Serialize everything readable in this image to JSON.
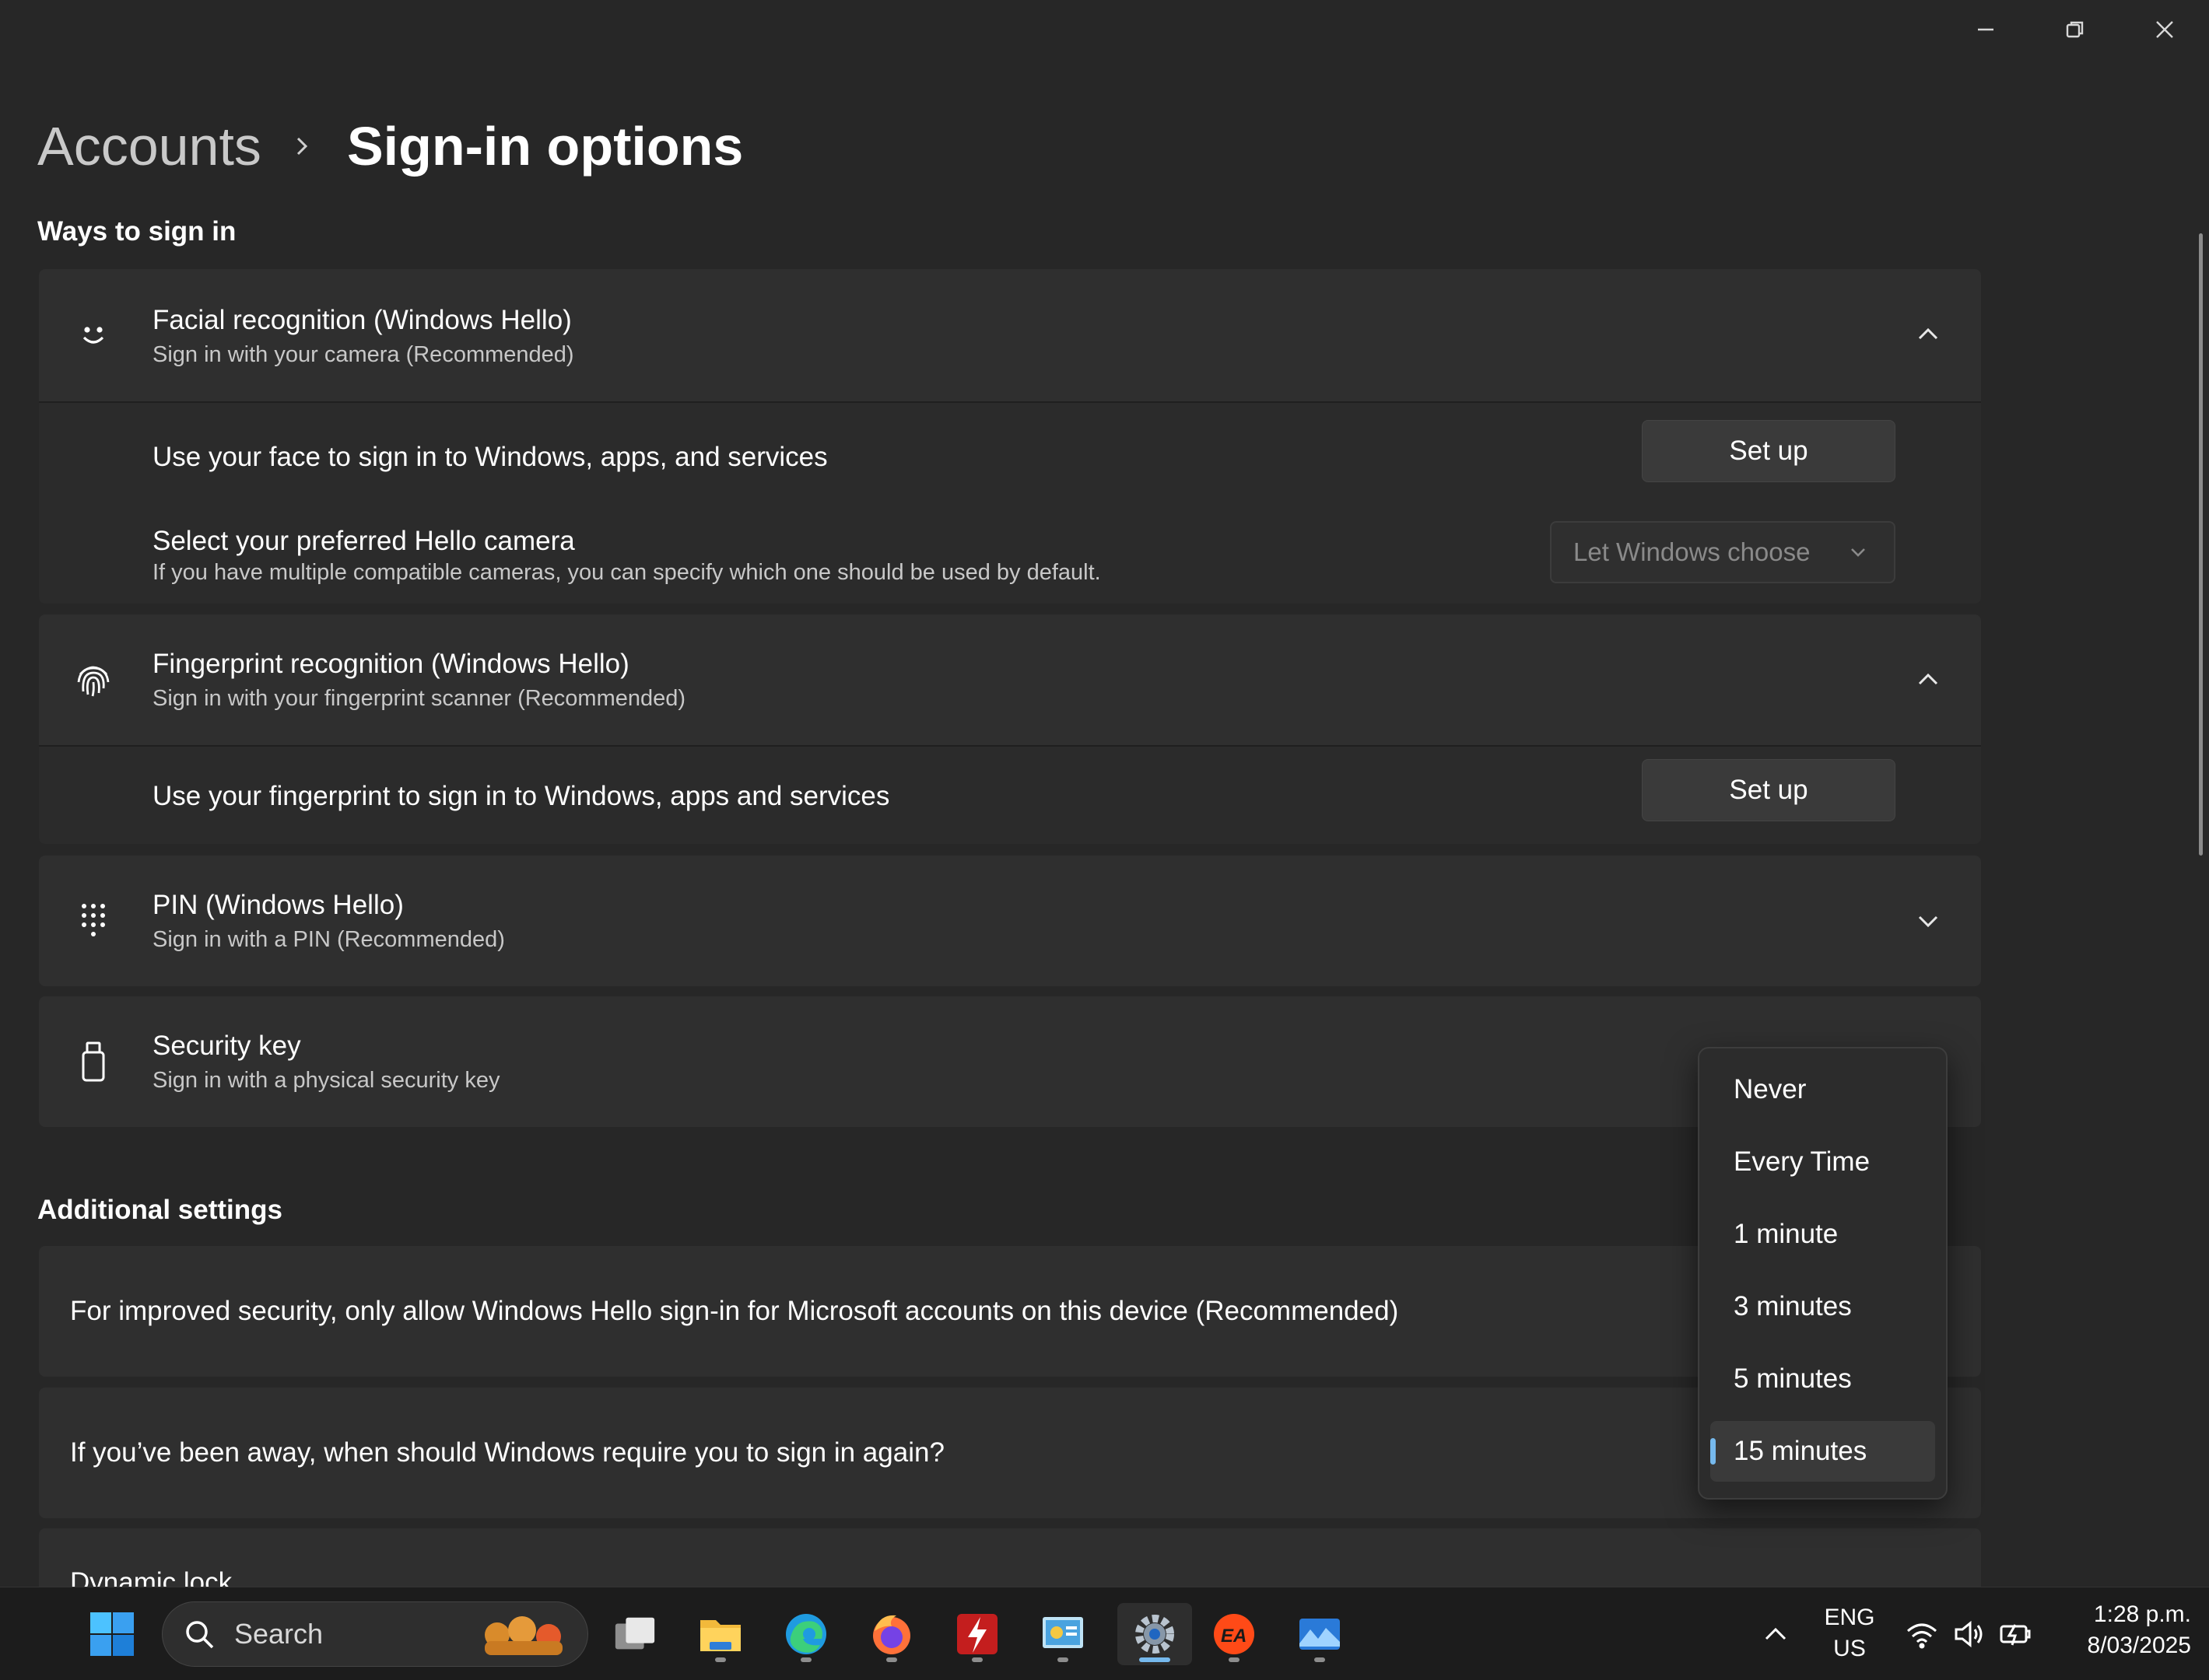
{
  "window": {
    "minimize_icon": "minimize-icon",
    "restore_icon": "restore-icon",
    "close_icon": "close-icon"
  },
  "breadcrumb": {
    "parent": "Accounts",
    "current": "Sign-in options"
  },
  "ways_section": {
    "title": "Ways to sign in",
    "facial": {
      "title": "Facial recognition (Windows Hello)",
      "subtitle": "Sign in with your camera (Recommended)",
      "row1_label": "Use your face to sign in to Windows, apps, and services",
      "row1_button": "Set up",
      "row2_label": "Select your preferred Hello camera",
      "row2_sub": "If you have multiple compatible cameras, you can specify which one should be used by default.",
      "camera_select_value": "Let Windows choose"
    },
    "fingerprint": {
      "title": "Fingerprint recognition (Windows Hello)",
      "subtitle": "Sign in with your fingerprint scanner (Recommended)",
      "row1_label": "Use your fingerprint to sign in to Windows, apps and services",
      "row1_button": "Set up"
    },
    "pin": {
      "title": "PIN (Windows Hello)",
      "subtitle": "Sign in with a PIN (Recommended)"
    },
    "security_key": {
      "title": "Security key",
      "subtitle": "Sign in with a physical security key"
    }
  },
  "additional_section": {
    "title": "Additional settings",
    "hello_only": "For improved security, only allow Windows Hello sign-in for Microsoft accounts on this device (Recommended)",
    "away_question": "If you’ve been away, when should Windows require you to sign in again?",
    "dynamic_lock": "Dynamic lock"
  },
  "dropdown": {
    "options": [
      "Never",
      "Every Time",
      "1 minute",
      "3 minutes",
      "5 minutes",
      "15 minutes"
    ],
    "selected": "15 minutes",
    "accent_color": "#76b9ed"
  },
  "taskbar": {
    "search_placeholder": "Search",
    "language_line1": "ENG",
    "language_line2": "US",
    "time": "1:28 p.m.",
    "date": "8/03/2025",
    "apps": [
      "start",
      "task-view",
      "file-explorer",
      "edge",
      "firefox",
      "bolt-app",
      "control-panel",
      "settings",
      "ea-app",
      "photos"
    ]
  }
}
